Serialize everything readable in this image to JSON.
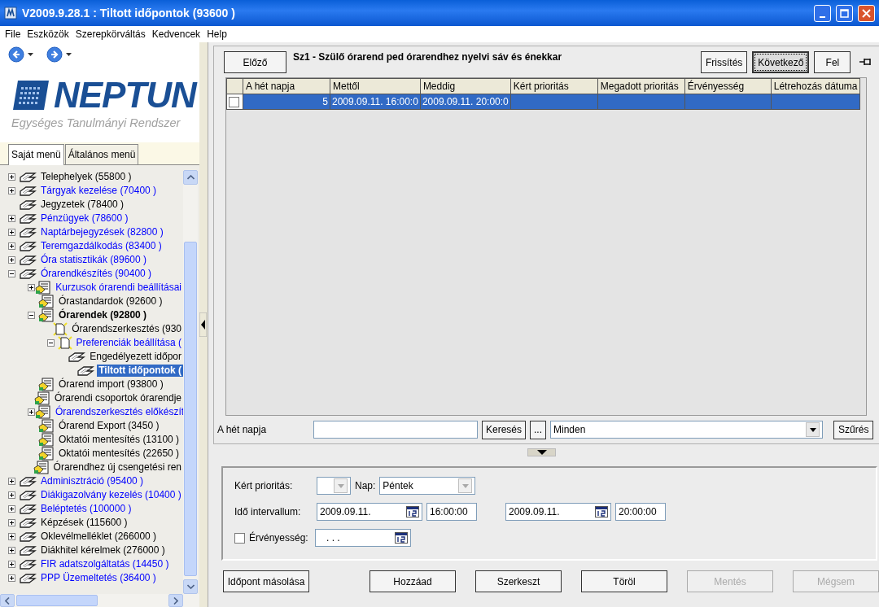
{
  "window": {
    "title": "V2009.9.28.1 : Tiltott időpontok (93600 )"
  },
  "menu": [
    "File",
    "Eszközök",
    "Szerepkörváltás",
    "Kedvencek",
    "Help"
  ],
  "logo": {
    "name": "NEPTUN",
    "tagline": "Egységes Tanulmányi Rendszer"
  },
  "menu_tabs": [
    {
      "label": "Saját menü",
      "selected": true
    },
    {
      "label": "Általános menü",
      "selected": false
    }
  ],
  "tree": [
    {
      "label": "Telephelyek (55800 )",
      "kind": "book",
      "color": "#000000",
      "expanded": false,
      "bold": false,
      "selected": false
    },
    {
      "label": "Tárgyak kezelése (70400 )",
      "kind": "book",
      "color": "#0000ff",
      "expanded": false,
      "bold": false,
      "selected": false
    },
    {
      "label": "Jegyzetek (78400 )",
      "kind": "book",
      "color": "#000000",
      "bold": false,
      "selected": false
    },
    {
      "label": "Pénzügyek (78600 )",
      "kind": "book",
      "color": "#0000ff",
      "expanded": false,
      "bold": false,
      "selected": false
    },
    {
      "label": "Naptárbejegyzések (82800 )",
      "kind": "book",
      "color": "#0000ff",
      "expanded": false,
      "bold": false,
      "selected": false
    },
    {
      "label": "Teremgazdálkodás (83400 )",
      "kind": "book",
      "color": "#0000ff",
      "expanded": false,
      "bold": false,
      "selected": false
    },
    {
      "label": "Óra statisztikák (89600 )",
      "kind": "book",
      "color": "#0000ff",
      "expanded": false,
      "bold": false,
      "selected": false
    },
    {
      "label": "Órarendkészítés (90400 )",
      "kind": "book",
      "color": "#0000ff",
      "expanded": true,
      "bold": false,
      "selected": false,
      "children": [
        {
          "label": "Kurzusok órarendi beállításai",
          "kind": "form",
          "color": "#0000ff",
          "expanded": false,
          "bold": false,
          "selected": false
        },
        {
          "label": "Órastandardok (92600 )",
          "kind": "form",
          "color": "#000000",
          "bold": false,
          "selected": false
        },
        {
          "label": "Órarendek (92800 )",
          "kind": "form",
          "color": "#000000",
          "expanded": true,
          "bold": true,
          "selected": false,
          "children": [
            {
              "label": "Órarendszerkesztés (930",
              "kind": "page",
              "color": "#000000",
              "bold": false,
              "selected": false
            },
            {
              "label": "Preferenciák beállítása (",
              "kind": "page",
              "color": "#0000ff",
              "expanded": true,
              "bold": false,
              "selected": false,
              "children": [
                {
                  "label": "Engedélyezett időpor",
                  "kind": "book",
                  "color": "#000000",
                  "bold": false,
                  "selected": false
                },
                {
                  "label": "Tiltott időpontok (",
                  "kind": "book",
                  "bold": true,
                  "selected": true
                }
              ]
            }
          ]
        },
        {
          "label": "Órarend import (93800 )",
          "kind": "form",
          "color": "#000000",
          "bold": false,
          "selected": false
        },
        {
          "label": "Órarendi csoportok órarendje",
          "kind": "form",
          "color": "#000000",
          "bold": false,
          "selected": false
        },
        {
          "label": "Órarendszerkesztés előkészít",
          "kind": "form",
          "color": "#0000ff",
          "expanded": false,
          "bold": false,
          "selected": false
        },
        {
          "label": "Órarend Export (3450 )",
          "kind": "form",
          "color": "#000000",
          "bold": false,
          "selected": false
        },
        {
          "label": "Oktatói mentesítés (13100 )",
          "kind": "form",
          "color": "#000000",
          "bold": false,
          "selected": false
        },
        {
          "label": "Oktatói mentesítés (22650 )",
          "kind": "form",
          "color": "#000000",
          "bold": false,
          "selected": false
        },
        {
          "label": "Órarendhez új csengetési ren",
          "kind": "form",
          "color": "#000000",
          "bold": false,
          "selected": false
        }
      ]
    },
    {
      "label": "Adminisztráció (95400 )",
      "kind": "book",
      "color": "#0000ff",
      "expanded": false,
      "bold": false,
      "selected": false
    },
    {
      "label": "Diákigazolvány kezelés (10400 )",
      "kind": "book",
      "color": "#0000ff",
      "expanded": false,
      "bold": false,
      "selected": false
    },
    {
      "label": "Beléptetés (100000 )",
      "kind": "book",
      "color": "#0000ff",
      "expanded": false,
      "bold": false,
      "selected": false
    },
    {
      "label": "Képzések (115600 )",
      "kind": "book",
      "color": "#000000",
      "expanded": false,
      "bold": false,
      "selected": false
    },
    {
      "label": "Oklevélmelléklet (266000 )",
      "kind": "book",
      "color": "#000000",
      "expanded": false,
      "bold": false,
      "selected": false
    },
    {
      "label": "Diákhitel kérelmek (276000 )",
      "kind": "book",
      "color": "#000000",
      "expanded": false,
      "bold": false,
      "selected": false
    },
    {
      "label": "FIR adatszolgáltatás (14450 )",
      "kind": "book",
      "color": "#0000ff",
      "expanded": false,
      "bold": false,
      "selected": false
    },
    {
      "label": "PPP Üzemeltetés (36400 )",
      "kind": "book",
      "color": "#0000ff",
      "expanded": false,
      "bold": false,
      "selected": false
    }
  ],
  "header": {
    "prev_button": "Előző",
    "title": "Sz1 - Szülő órarend ped órarendhez nyelvi sáv és énekkar",
    "buttons": [
      {
        "label": "Frissítés",
        "focused": false
      },
      {
        "label": "Következő",
        "focused": true
      },
      {
        "label": "Fel",
        "focused": false
      }
    ]
  },
  "grid": {
    "columns": [
      "A hét napja",
      "Mettől",
      "Meddig",
      "Kért prioritás",
      "Megadott prioritás",
      "Érvényesség",
      "Létrehozás dátuma"
    ],
    "rows": [
      {
        "selected": true,
        "checked": false,
        "cells": [
          "5",
          "2009.09.11. 16:00:0",
          "2009.09.11. 20:00:0"
        ]
      }
    ]
  },
  "search": {
    "label": "A hét napja",
    "search_button": "Keresés",
    "more_button": "...",
    "filter": "Minden",
    "filter_button": "Szűrés"
  },
  "details": {
    "priority_label": "Kért prioritás:",
    "day_label": "Nap:",
    "day": "Péntek",
    "interval_label": "Idő intervallum:",
    "from_date": "2009.09.11.",
    "from_time": "16:00:00",
    "to_date": "2009.09.11.",
    "to_time": "20:00:00",
    "validity_checked": false,
    "validity_label": "Érvényesség:",
    "validity_date": ". . ."
  },
  "actions": [
    {
      "label": "Időpont másolása",
      "disabled": false
    },
    {
      "label": "Hozzáad",
      "disabled": false
    },
    {
      "label": "Szerkeszt",
      "disabled": false
    },
    {
      "label": "Töröl",
      "disabled": false
    },
    {
      "label": "Mentés",
      "disabled": true
    },
    {
      "label": "Mégsem",
      "disabled": true
    }
  ]
}
